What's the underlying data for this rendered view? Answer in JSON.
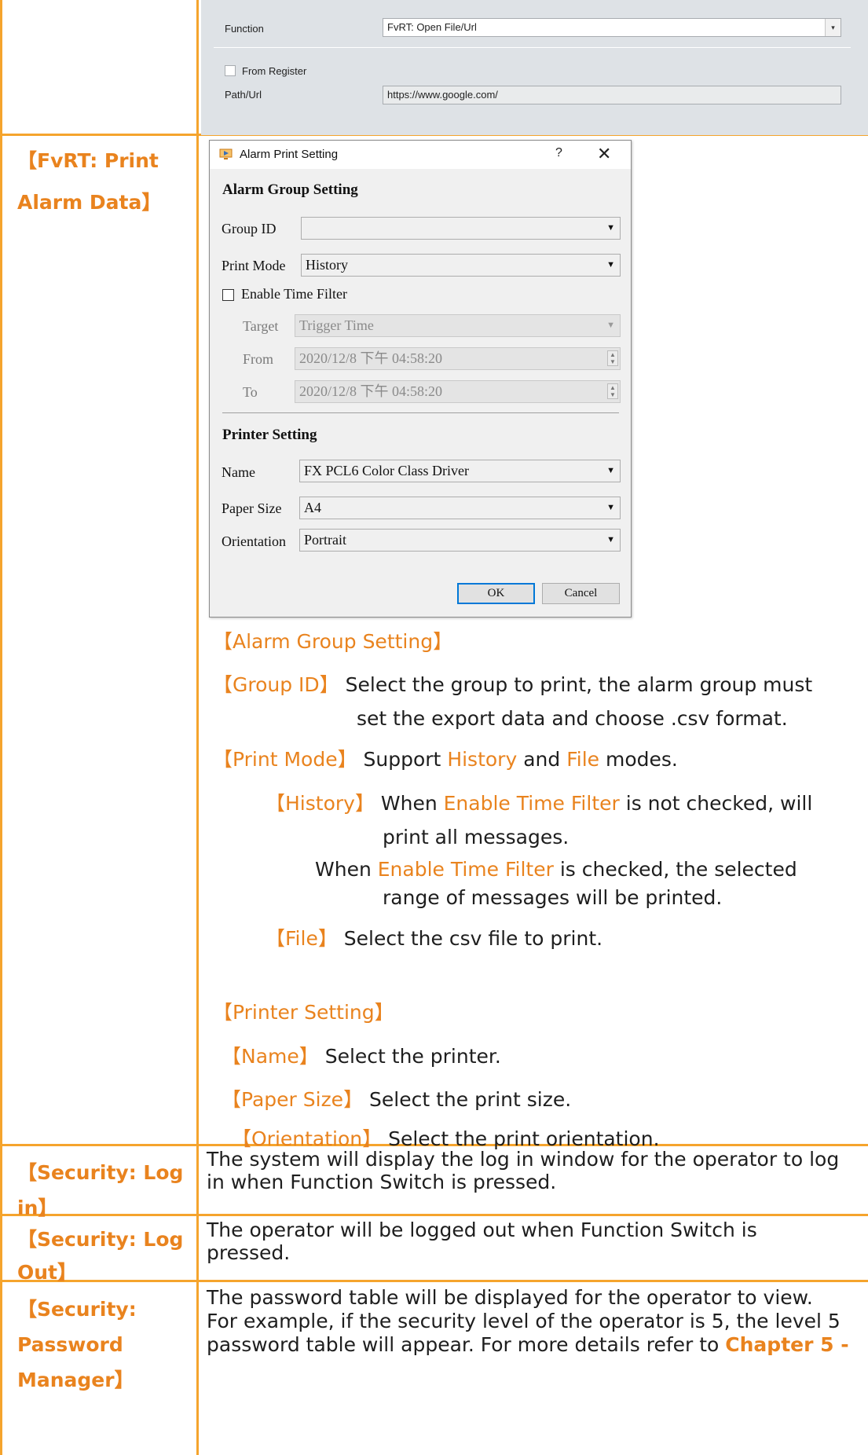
{
  "function_panel": {
    "function_label": "Function",
    "function_value": "FvRT: Open File/Url",
    "from_register_label": "From Register",
    "path_label": "Path/Url",
    "path_value": "https://www.google.com/"
  },
  "rows": [
    {
      "label_lines": [
        "【FvRT: Print",
        "Alarm Data】"
      ]
    },
    {
      "label_lines": [
        "【Security: Log",
        "in】"
      ],
      "desc_lines": [
        "The system will display the log in window for the operator to log",
        "in when Function Switch is pressed."
      ]
    },
    {
      "label_lines": [
        "【Security: Log",
        "Out】"
      ],
      "desc_lines": [
        "The operator will be logged out when Function Switch is",
        "pressed."
      ]
    },
    {
      "label_lines": [
        "【Security:",
        "Password",
        "Manager】"
      ],
      "desc_lines": [
        "The password table will be displayed for the operator to view.",
        "For example, if the security level of the operator is 5, the level 5",
        "password table will appear. For more details refer to "
      ],
      "desc_link": "Chapter 5 -"
    }
  ],
  "dialog": {
    "title": "Alarm Print Setting",
    "help": "?",
    "close": "✕",
    "alarm_group_heading": "Alarm Group Setting",
    "group_id_label": "Group ID",
    "group_id_value": "",
    "print_mode_label": "Print Mode",
    "print_mode_value": "History",
    "enable_time_filter_label": "Enable Time Filter",
    "target_label": "Target",
    "target_value": "Trigger Time",
    "from_label": "From",
    "from_value": "2020/12/8 下午 04:58:20",
    "to_label": "To",
    "to_value": "2020/12/8 下午 04:58:20",
    "printer_heading": "Printer Setting",
    "name_label": "Name",
    "name_value": "FX PCL6 Color Class Driver",
    "paper_size_label": "Paper Size",
    "paper_size_value": "A4",
    "orientation_label": "Orientation",
    "orientation_value": "Portrait",
    "ok": "OK",
    "cancel": "Cancel"
  },
  "explanation": {
    "alarm_group_title": "【Alarm Group Setting】",
    "group_id_key": "【Group ID】",
    "group_id_text1": " Select the group to print, the alarm group must",
    "group_id_text2": "set the export data and choose .csv format.",
    "print_mode_key": "【Print Mode】",
    "print_mode_pre": " Support ",
    "print_mode_history": "History",
    "print_mode_and": " and ",
    "print_mode_file": "File",
    "print_mode_post": " modes.",
    "history_key": "【History】",
    "history_pre": " When ",
    "history_etf": "Enable Time Filter",
    "history_post": " is not checked, will",
    "history_line2": "print all messages.",
    "history2_pre": "When ",
    "history2_etf": "Enable Time Filter",
    "history2_post": " is checked, the selected",
    "history2_line2": "range of messages will be printed.",
    "file_key": "【File】",
    "file_text": " Select the csv file to print.",
    "printer_title": "【Printer Setting】",
    "name_key": "【Name】",
    "name_text": " Select the printer.",
    "paper_key": "【Paper Size】",
    "paper_text": " Select the print size.",
    "orient_key": "【Orientation】",
    "orient_text": " Select the print orientation."
  },
  "colors": {
    "accent": "#e9831e",
    "border": "#f5a42d",
    "text": "#1e1e1e"
  }
}
